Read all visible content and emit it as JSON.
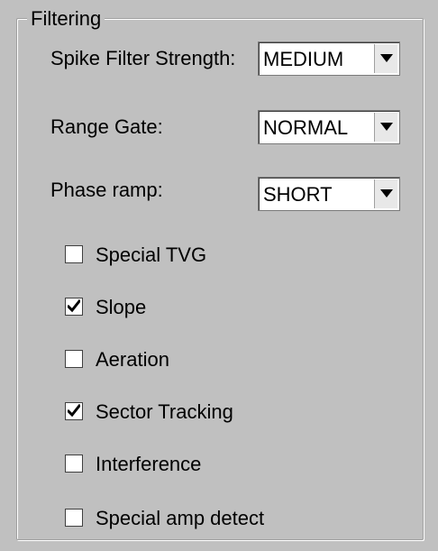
{
  "group": {
    "title": "Filtering"
  },
  "fields": [
    {
      "label": "Spike Filter Strength:",
      "value": "MEDIUM"
    },
    {
      "label": "Range Gate:",
      "value": "NORMAL"
    },
    {
      "label": "Phase ramp:",
      "value": "SHORT"
    }
  ],
  "checkboxes": [
    {
      "label": "Special TVG",
      "checked": false
    },
    {
      "label": "Slope",
      "checked": true
    },
    {
      "label": "Aeration",
      "checked": false
    },
    {
      "label": "Sector Tracking",
      "checked": true
    },
    {
      "label": "Interference",
      "checked": false
    },
    {
      "label": "Special amp detect",
      "checked": false
    }
  ],
  "icons": {
    "dropdown": "chevron-down-icon",
    "check": "checkmark-icon"
  }
}
